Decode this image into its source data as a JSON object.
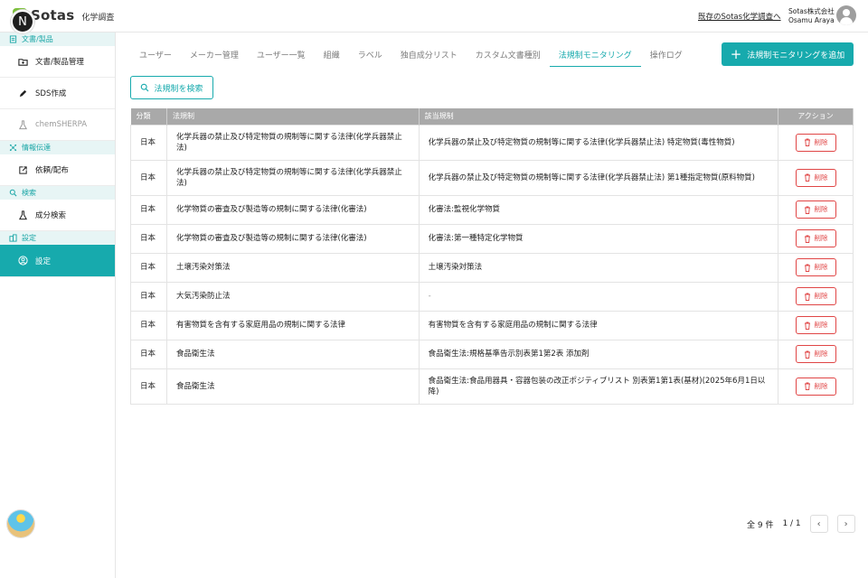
{
  "header": {
    "badge_letter": "N",
    "logo_text": "Sotas",
    "logo_sub": "化学調査",
    "existing_link": "既存のSotas化学調査へ",
    "company": "Sotas株式会社",
    "user_name": "Osamu Araya"
  },
  "sidebar": {
    "sections": [
      {
        "title": "文書/製品",
        "items": [
          {
            "label": "文書/製品管理",
            "state": "normal"
          },
          {
            "label": "SDS作成",
            "state": "normal"
          },
          {
            "label": "chemSHERPA",
            "state": "disabled"
          }
        ]
      },
      {
        "title": "情報伝達",
        "items": [
          {
            "label": "依頼/配布",
            "state": "normal"
          }
        ]
      },
      {
        "title": "検索",
        "items": [
          {
            "label": "成分検索",
            "state": "normal"
          }
        ]
      },
      {
        "title": "設定",
        "items": [
          {
            "label": "設定",
            "state": "active"
          }
        ]
      }
    ]
  },
  "tabs": [
    "ユーザー",
    "メーカー管理",
    "ユーザー一覧",
    "組織",
    "ラベル",
    "独自成分リスト",
    "カスタム文書種別",
    "法規制モニタリング",
    "操作ログ"
  ],
  "active_tab": 7,
  "add_button": "法規制モニタリングを追加",
  "search_button": "法規制を検索",
  "table": {
    "headers": [
      "分類",
      "法規制",
      "該当規制",
      "アクション"
    ],
    "delete_label": "削除",
    "rows": [
      {
        "category": "日本",
        "law": "化学兵器の禁止及び特定物質の規制等に関する法律(化学兵器禁止法)",
        "regulation": "化学兵器の禁止及び特定物質の規制等に関する法律(化学兵器禁止法) 特定物質(毒性物質)"
      },
      {
        "category": "日本",
        "law": "化学兵器の禁止及び特定物質の規制等に関する法律(化学兵器禁止法)",
        "regulation": "化学兵器の禁止及び特定物質の規制等に関する法律(化学兵器禁止法) 第1種指定物質(原料物質)"
      },
      {
        "category": "日本",
        "law": "化学物質の審査及び製造等の規制に関する法律(化審法)",
        "regulation": "化審法:監視化学物質"
      },
      {
        "category": "日本",
        "law": "化学物質の審査及び製造等の規制に関する法律(化審法)",
        "regulation": "化審法:第一種特定化学物質"
      },
      {
        "category": "日本",
        "law": "土壌汚染対策法",
        "regulation": "土壌汚染対策法"
      },
      {
        "category": "日本",
        "law": "大気汚染防止法",
        "regulation": "-"
      },
      {
        "category": "日本",
        "law": "有害物質を含有する家庭用品の規制に関する法律",
        "regulation": "有害物質を含有する家庭用品の規制に関する法律"
      },
      {
        "category": "日本",
        "law": "食品衛生法",
        "regulation": "食品衛生法:規格基準告示別表第1第2表 添加剤"
      },
      {
        "category": "日本",
        "law": "食品衛生法",
        "regulation": "食品衛生法:食品用器具・容器包装の改正ポジティブリスト 別表第1第1表(基材)(2025年6月1日以降)"
      }
    ]
  },
  "pagination": {
    "total": "全 9 件",
    "page": "1 / 1",
    "prev": "‹",
    "next": "›"
  },
  "colors": {
    "accent": "#17aaad",
    "danger": "#e04545",
    "header_gray": "#a9a9a9"
  }
}
